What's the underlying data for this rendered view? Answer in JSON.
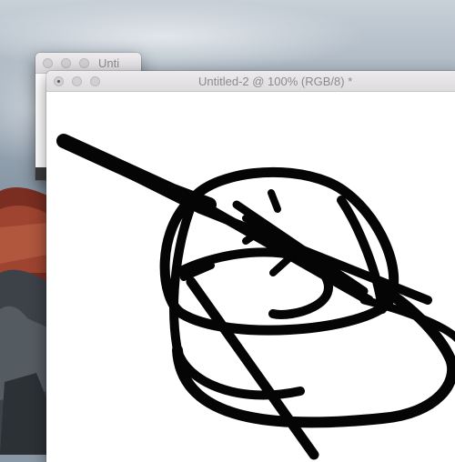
{
  "back_window": {
    "title": "Unti"
  },
  "front_window": {
    "title": "Untitled-2 @ 100% (RGB/8) *"
  },
  "colors": {
    "stroke": "#050505",
    "canvas": "#ffffff",
    "titlebar": "#e5e3e5"
  },
  "icons": [
    "close-button",
    "minimize-button",
    "zoom-button"
  ]
}
